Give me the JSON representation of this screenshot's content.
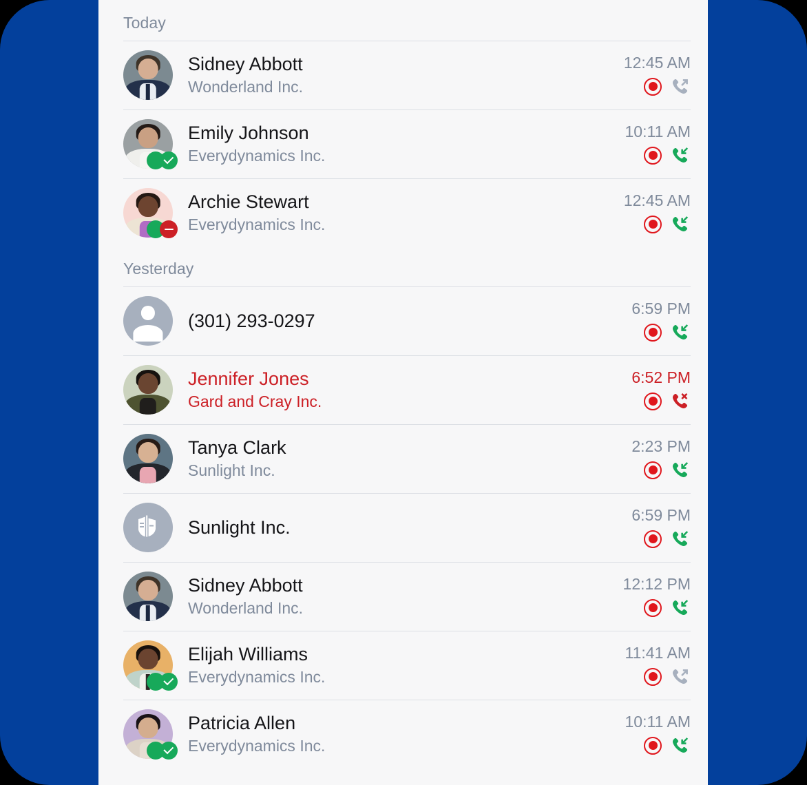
{
  "theme": {
    "backdrop_color": "#03409C",
    "panel_bg": "#F7F7F8",
    "primary_text": "#151518",
    "secondary_text": "#7F8A9B",
    "missed_color": "#CC2026",
    "record_color": "#E0161C",
    "incoming_color": "#17A95A",
    "outgoing_color": "#A7B0BE",
    "divider_color": "#DCDFE4",
    "available_badge": "#17A95A",
    "dnd_badge": "#CC2026"
  },
  "sections": [
    {
      "id": "today",
      "header": "Today",
      "rows": [
        {
          "name": "Sidney Abbott",
          "company": "Wonderland Inc.",
          "time": "12:45 AM",
          "record_icon": "record-icon",
          "call_icon": "call-outgoing-icon",
          "call_direction": "outgoing",
          "missed": false,
          "avatar_type": "photo",
          "avatar_name": "avatar-sidney-abbott",
          "presence": []
        },
        {
          "name": "Emily Johnson",
          "company": "Everydynamics Inc.",
          "time": "10:11 AM",
          "record_icon": "record-icon",
          "call_icon": "call-incoming-icon",
          "call_direction": "incoming",
          "missed": false,
          "avatar_type": "photo",
          "avatar_name": "avatar-emily-johnson",
          "presence": [
            "online",
            "available"
          ]
        },
        {
          "name": "Archie Stewart",
          "company": "Everydynamics Inc.",
          "time": "12:45 AM",
          "record_icon": "record-icon",
          "call_icon": "call-incoming-icon",
          "call_direction": "incoming",
          "missed": false,
          "avatar_type": "photo",
          "avatar_name": "avatar-archie-stewart",
          "presence": [
            "online",
            "dnd"
          ]
        }
      ]
    },
    {
      "id": "yesterday",
      "header": "Yesterday",
      "rows": [
        {
          "name": "(301) 293-0297",
          "company": "",
          "time": "6:59 PM",
          "record_icon": "record-icon",
          "call_icon": "call-incoming-icon",
          "call_direction": "incoming",
          "missed": false,
          "avatar_type": "default",
          "avatar_name": "avatar-unknown-caller",
          "presence": []
        },
        {
          "name": "Jennifer Jones",
          "company": "Gard and Cray Inc.",
          "time": "6:52 PM",
          "record_icon": "record-icon",
          "call_icon": "call-missed-icon",
          "call_direction": "missed",
          "missed": true,
          "avatar_type": "photo",
          "avatar_name": "avatar-jennifer-jones",
          "presence": []
        },
        {
          "name": "Tanya Clark",
          "company": "Sunlight Inc.",
          "time": "2:23 PM",
          "record_icon": "record-icon",
          "call_icon": "call-incoming-icon",
          "call_direction": "incoming",
          "missed": false,
          "avatar_type": "photo",
          "avatar_name": "avatar-tanya-clark",
          "presence": []
        },
        {
          "name": "Sunlight Inc.",
          "company": "",
          "time": "6:59 PM",
          "record_icon": "record-icon",
          "call_icon": "call-incoming-icon",
          "call_direction": "incoming",
          "missed": false,
          "avatar_type": "company",
          "avatar_name": "avatar-sunlight-inc",
          "presence": []
        },
        {
          "name": "Sidney Abbott",
          "company": "Wonderland Inc.",
          "time": "12:12 PM",
          "record_icon": "record-icon",
          "call_icon": "call-incoming-icon",
          "call_direction": "incoming",
          "missed": false,
          "avatar_type": "photo",
          "avatar_name": "avatar-sidney-abbott",
          "presence": []
        },
        {
          "name": "Elijah Williams",
          "company": "Everydynamics Inc.",
          "time": "11:41 AM",
          "record_icon": "record-icon",
          "call_icon": "call-outgoing-icon",
          "call_direction": "outgoing",
          "missed": false,
          "avatar_type": "photo",
          "avatar_name": "avatar-elijah-williams",
          "presence": [
            "online",
            "available"
          ]
        },
        {
          "name": "Patricia Allen",
          "company": "Everydynamics Inc.",
          "time": "10:11 AM",
          "record_icon": "record-icon",
          "call_icon": "call-incoming-icon",
          "call_direction": "incoming",
          "missed": false,
          "avatar_type": "photo",
          "avatar_name": "avatar-patricia-allen",
          "presence": [
            "online",
            "available"
          ]
        }
      ]
    }
  ]
}
